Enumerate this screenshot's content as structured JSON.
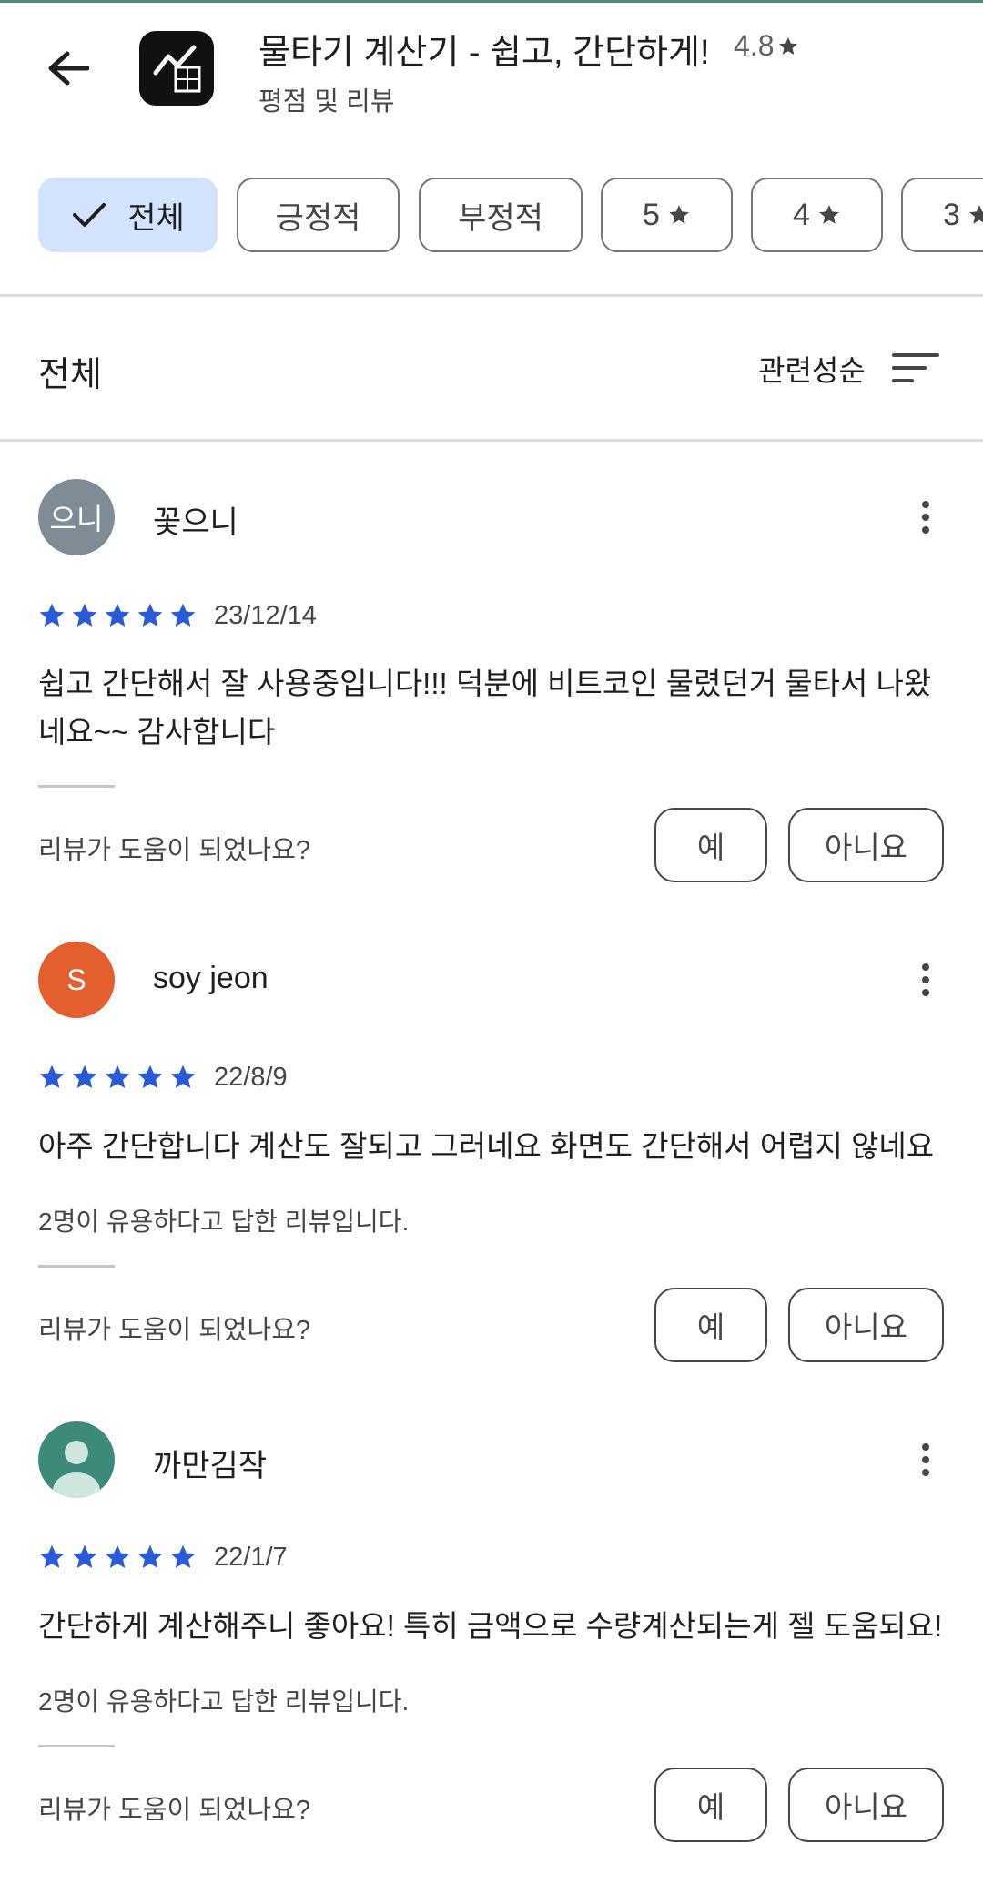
{
  "header": {
    "app_title": "물타기 계산기 - 쉽고, 간단하게!",
    "app_rating": "4.8",
    "subtitle": "평점 및 리뷰"
  },
  "filters": [
    {
      "label": "전체",
      "active": true
    },
    {
      "label": "긍정적",
      "active": false
    },
    {
      "label": "부정적",
      "active": false
    },
    {
      "label": "5",
      "star": true,
      "active": false
    },
    {
      "label": "4",
      "star": true,
      "active": false
    },
    {
      "label": "3",
      "star": true,
      "active": false
    }
  ],
  "section": {
    "title": "전체",
    "sort_label": "관련성순"
  },
  "colors": {
    "accent_chip": "#d3e3fd",
    "star_blue": "#2a5bd7"
  },
  "reviews": [
    {
      "avatar_text": "으니",
      "avatar_color": "#7f8c96",
      "author": "꽃으니",
      "rating": 5,
      "date": "23/12/14",
      "text": "쉽고 간단해서 잘 사용중입니다!!! 덕분에 비트코인 물렸던거 물타서 나왔네요~~ 감사합니다",
      "helpful_count": "",
      "helpful_question": "리뷰가 도움이 되었나요?",
      "yes": "예",
      "no": "아니요"
    },
    {
      "avatar_text": "S",
      "avatar_color": "#e35f2f",
      "author": "soy jeon",
      "rating": 5,
      "date": "22/8/9",
      "text": "아주 간단합니다 계산도 잘되고 그러네요 화면도 간단해서 어렵지 않네요",
      "helpful_count": "2명이 유용하다고 답한 리뷰입니다.",
      "helpful_question": "리뷰가 도움이 되었나요?",
      "yes": "예",
      "no": "아니요"
    },
    {
      "avatar_text": "",
      "avatar_color": "#3d8a7a",
      "author": "까만김작",
      "rating": 5,
      "date": "22/1/7",
      "text": "간단하게 계산해주니 좋아요! 특히 금액으로 수량계산되는게 젤 도움되요!",
      "helpful_count": "2명이 유용하다고 답한 리뷰입니다.",
      "helpful_question": "리뷰가 도움이 되었나요?",
      "yes": "예",
      "no": "아니요"
    }
  ]
}
